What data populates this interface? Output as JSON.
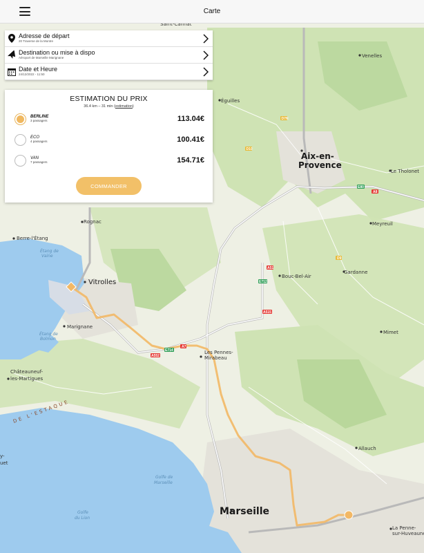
{
  "header": {
    "title": "Carte",
    "menu_icon": "hamburger-menu-icon"
  },
  "form": {
    "departure": {
      "label": "Adresse de départ",
      "value": "20 Traverse de la Montre",
      "icon": "map-pin-icon"
    },
    "destination": {
      "label": "Destination ou mise à dispo",
      "value": "Aéroport de Marseille Marignane",
      "icon": "airplane-icon"
    },
    "datetime": {
      "label": "Date et Heure",
      "value": "24/12/2022 - 11:50",
      "icon": "calendar-icon"
    }
  },
  "estimate": {
    "title": "ESTIMATION DU PRIX",
    "summary": "36.4 km – 31 min (",
    "link": "estimation",
    "summary_end": ")",
    "options": [
      {
        "name": "BERLINE",
        "passengers": "3 passagers",
        "price": "113.04€",
        "selected": true
      },
      {
        "name": "ECO",
        "passengers": "4 passagers",
        "price": "100.41€",
        "selected": false
      },
      {
        "name": "VAN",
        "passengers": "7 passagers",
        "price": "154.71€",
        "selected": false
      }
    ],
    "order_button": "COMMANDER",
    "accent_color": "#f2c068"
  },
  "map": {
    "places": {
      "aix": [
        "Aix-en-",
        "Provence"
      ],
      "marseille": "Marseille",
      "vitrolles": "Vitrolles",
      "marignane": "Marignane",
      "pennes": [
        "Les Pennes-",
        "Mirabeau"
      ],
      "berre": "Berre-l'Étang",
      "rognac": "Rognac",
      "chateauneuf": [
        "Châteauneuf-",
        "les-Martigues"
      ],
      "gardanne": "Gardanne",
      "bouc": "Bouc-Bel-Air",
      "allauch": "Allauch",
      "mimet": "Mimet",
      "meyreuil": "Meyreuil",
      "tholonet": "Le Tholonet",
      "venelles": "Venelles",
      "eguilles": "Éguilles",
      "penne_huveaune": [
        "La Penne-",
        "sur-Huveaune"
      ],
      "saint_cannat": "Saint-Cannat",
      "estaque": "DE L'ESTAQUE",
      "etang_vaine": [
        "Étang de",
        "Vaïne"
      ],
      "etang_bolmon": [
        "Étang de",
        "Bolmon"
      ],
      "golfe_marseille": [
        "Golfe de",
        "Marseille"
      ],
      "golfe_lion": [
        "Golfe",
        "du Lion"
      ],
      "ry_uet": [
        "y-",
        "uet"
      ]
    },
    "roads": [
      "D7N",
      "D10",
      "D9",
      "A8",
      "E80",
      "A51",
      "E712",
      "A515",
      "A7",
      "E714",
      "A552"
    ]
  }
}
